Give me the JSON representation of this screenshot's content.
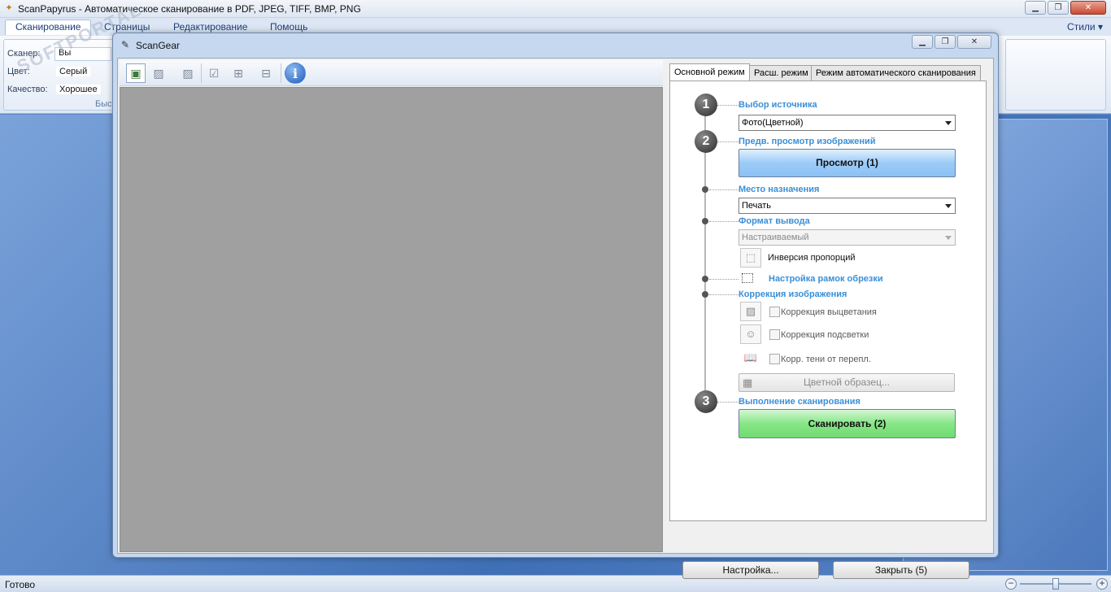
{
  "app": {
    "title": "ScanPapyrus - Автоматическое сканирование в PDF, JPEG, TIFF, BMP, PNG",
    "icon": "papyrus-icon"
  },
  "ribbon": {
    "tabs": [
      {
        "label": "Сканирование",
        "active": true
      },
      {
        "label": "Страницы",
        "active": false
      },
      {
        "label": "Редактирование",
        "active": false
      },
      {
        "label": "Помощь",
        "active": false
      }
    ],
    "styles_label": "Стили",
    "group": {
      "scanner_label": "Сканер:",
      "scanner_value": "Вы",
      "color_label": "Цвет:",
      "color_value": "Серый",
      "quality_label": "Качество:",
      "quality_value": "Хорошее",
      "caption": "Быс"
    }
  },
  "status": {
    "text": "Готово"
  },
  "dialog": {
    "title": "ScanGear",
    "tabs": [
      {
        "label": "Основной режим",
        "active": true
      },
      {
        "label": "Расш. режим",
        "active": false
      },
      {
        "label": "Режим автоматического сканирования",
        "active": false
      }
    ],
    "step1": {
      "num": "1",
      "title": "Выбор источника",
      "source_value": "Фото(Цветной)"
    },
    "step2": {
      "num": "2",
      "title": "Предв. просмотр изображений",
      "preview_button": "Просмотр (1)"
    },
    "destination": {
      "title": "Место назначения",
      "value": "Печать"
    },
    "output_format": {
      "title": "Формат вывода",
      "value": "Настраиваемый",
      "invert_label": "Инверсия пропорций"
    },
    "crop": {
      "title": "Настройка рамок обрезки"
    },
    "correction": {
      "title": "Коррекция изображения",
      "fading_label": "Коррекция выцветания",
      "backlight_label": "Коррекция подсветки",
      "gutter_label": "Корр. тени от перепл.",
      "color_pattern_button": "Цветной образец..."
    },
    "step3": {
      "num": "3",
      "title": "Выполнение сканирования",
      "scan_button": "Сканировать (2)"
    },
    "footer": {
      "settings_button": "Настройка...",
      "close_button": "Закрыть (5)"
    },
    "toolbar_icons": [
      "image-icon",
      "image-icon",
      "image-icon",
      "checkbox-grid-icon",
      "grid-icon",
      "grid-icon",
      "info-icon"
    ]
  },
  "colors": {
    "accent_title": "#3a8fd8",
    "preview_bg": "#a0a0a0",
    "scan_button": "#86e686",
    "preview_button": "#9ccbf7"
  }
}
